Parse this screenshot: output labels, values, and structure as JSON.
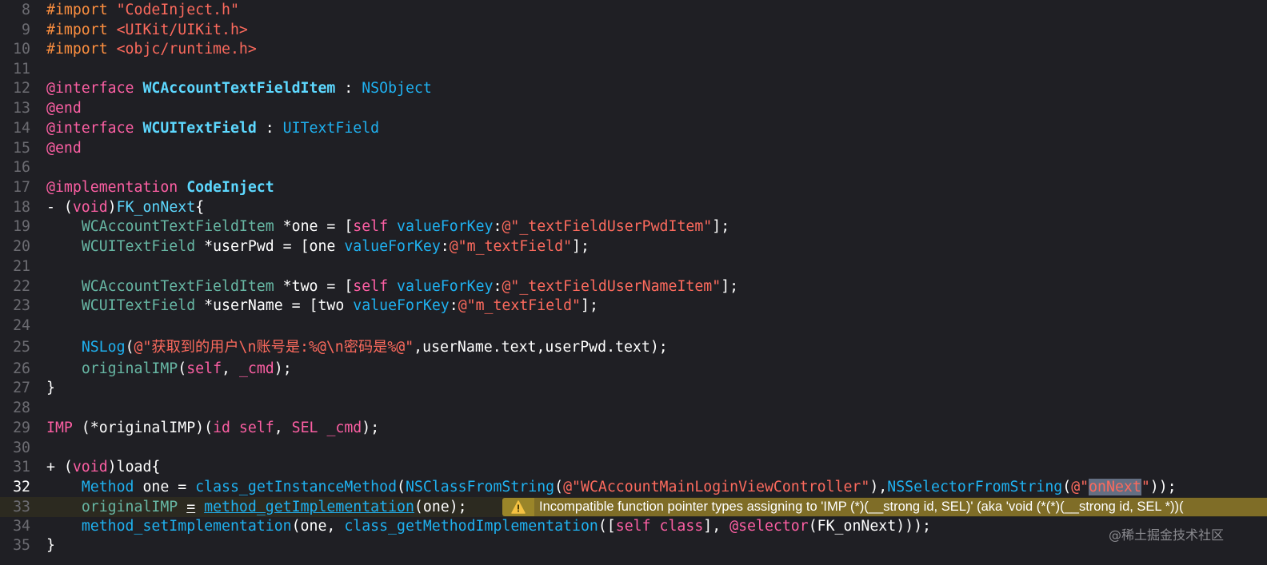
{
  "lines": [
    {
      "num": "8",
      "parts": [
        {
          "t": "#import ",
          "c": "dir"
        },
        {
          "t": "\"CodeInject.h\"",
          "c": "str"
        }
      ]
    },
    {
      "num": "9",
      "parts": [
        {
          "t": "#import ",
          "c": "dir"
        },
        {
          "t": "<UIKit/UIKit.h>",
          "c": "str"
        }
      ]
    },
    {
      "num": "10",
      "parts": [
        {
          "t": "#import ",
          "c": "dir"
        },
        {
          "t": "<objc/runtime.h>",
          "c": "str"
        }
      ]
    },
    {
      "num": "11",
      "parts": []
    },
    {
      "num": "12",
      "parts": [
        {
          "t": "@interface ",
          "c": "kw"
        },
        {
          "t": "WCAccountTextFieldItem",
          "c": "pc"
        },
        {
          "t": " : "
        },
        {
          "t": "NSObject",
          "c": "sy"
        }
      ]
    },
    {
      "num": "13",
      "parts": [
        {
          "t": "@end",
          "c": "kw"
        }
      ]
    },
    {
      "num": "14",
      "parts": [
        {
          "t": "@interface ",
          "c": "kw"
        },
        {
          "t": "WCUITextField",
          "c": "pc"
        },
        {
          "t": " : "
        },
        {
          "t": "UITextField",
          "c": "sy"
        }
      ]
    },
    {
      "num": "15",
      "parts": [
        {
          "t": "@end",
          "c": "kw"
        }
      ]
    },
    {
      "num": "16",
      "parts": []
    },
    {
      "num": "17",
      "parts": [
        {
          "t": "@implementation ",
          "c": "kw"
        },
        {
          "t": "CodeInject",
          "c": "pc"
        }
      ]
    },
    {
      "num": "18",
      "parts": [
        {
          "t": "- ("
        },
        {
          "t": "void",
          "c": "kw"
        },
        {
          "t": ")"
        },
        {
          "t": "FK_onNext",
          "c": "ty"
        },
        {
          "t": "{"
        }
      ]
    },
    {
      "num": "19",
      "parts": [
        {
          "t": "    "
        },
        {
          "t": "WCAccountTextFieldItem",
          "c": "uf"
        },
        {
          "t": " *one = ["
        },
        {
          "t": "self",
          "c": "kw"
        },
        {
          "t": " "
        },
        {
          "t": "valueForKey",
          "c": "sy"
        },
        {
          "t": ":"
        },
        {
          "t": "@\"_textFieldUserPwdItem\"",
          "c": "str"
        },
        {
          "t": "];"
        }
      ]
    },
    {
      "num": "20",
      "parts": [
        {
          "t": "    "
        },
        {
          "t": "WCUITextField",
          "c": "uf"
        },
        {
          "t": " *userPwd = [one "
        },
        {
          "t": "valueForKey",
          "c": "sy"
        },
        {
          "t": ":"
        },
        {
          "t": "@\"m_textField\"",
          "c": "str"
        },
        {
          "t": "];"
        }
      ]
    },
    {
      "num": "21",
      "parts": []
    },
    {
      "num": "22",
      "parts": [
        {
          "t": "    "
        },
        {
          "t": "WCAccountTextFieldItem",
          "c": "uf"
        },
        {
          "t": " *two = ["
        },
        {
          "t": "self",
          "c": "kw"
        },
        {
          "t": " "
        },
        {
          "t": "valueForKey",
          "c": "sy"
        },
        {
          "t": ":"
        },
        {
          "t": "@\"_textFieldUserNameItem\"",
          "c": "str"
        },
        {
          "t": "];"
        }
      ]
    },
    {
      "num": "23",
      "parts": [
        {
          "t": "    "
        },
        {
          "t": "WCUITextField",
          "c": "uf"
        },
        {
          "t": " *userName = [two "
        },
        {
          "t": "valueForKey",
          "c": "sy"
        },
        {
          "t": ":"
        },
        {
          "t": "@\"m_textField\"",
          "c": "str"
        },
        {
          "t": "];"
        }
      ]
    },
    {
      "num": "24",
      "parts": []
    },
    {
      "num": "25",
      "parts": [
        {
          "t": "    "
        },
        {
          "t": "NSLog",
          "c": "sy"
        },
        {
          "t": "("
        },
        {
          "t": "@\"获取到的用户\\n账号是:%@\\n密码是%@\"",
          "c": "str"
        },
        {
          "t": ",userName.text,userPwd.text);"
        }
      ]
    },
    {
      "num": "26",
      "parts": [
        {
          "t": "    "
        },
        {
          "t": "originalIMP",
          "c": "uf"
        },
        {
          "t": "("
        },
        {
          "t": "self",
          "c": "kw"
        },
        {
          "t": ", "
        },
        {
          "t": "_cmd",
          "c": "kw"
        },
        {
          "t": ");"
        }
      ]
    },
    {
      "num": "27",
      "parts": [
        {
          "t": "}"
        }
      ]
    },
    {
      "num": "28",
      "parts": []
    },
    {
      "num": "29",
      "parts": [
        {
          "t": "IMP",
          "c": "kw"
        },
        {
          "t": " (*originalIMP)("
        },
        {
          "t": "id",
          "c": "kw"
        },
        {
          "t": " "
        },
        {
          "t": "self",
          "c": "kw"
        },
        {
          "t": ", "
        },
        {
          "t": "SEL",
          "c": "kw"
        },
        {
          "t": " "
        },
        {
          "t": "_cmd",
          "c": "kw"
        },
        {
          "t": ");"
        }
      ]
    },
    {
      "num": "30",
      "parts": []
    },
    {
      "num": "31",
      "parts": [
        {
          "t": "+ ("
        },
        {
          "t": "void",
          "c": "kw"
        },
        {
          "t": ")load{"
        }
      ]
    },
    {
      "num": "32",
      "cur": true,
      "parts": [
        {
          "t": "    "
        },
        {
          "t": "Method",
          "c": "sy"
        },
        {
          "t": " one = "
        },
        {
          "t": "class_getInstanceMethod",
          "c": "sy"
        },
        {
          "t": "("
        },
        {
          "t": "NSClassFromString",
          "c": "sy"
        },
        {
          "t": "("
        },
        {
          "t": "@\"WCAccountMainLoginViewController\"",
          "c": "str"
        },
        {
          "t": "),"
        },
        {
          "t": "NSSelectorFromString",
          "c": "sy"
        },
        {
          "t": "("
        },
        {
          "t": "@\"",
          "c": "str"
        },
        {
          "t": "onNext",
          "c": "sel"
        },
        {
          "t": "\"",
          "c": "str"
        },
        {
          "t": "));"
        }
      ]
    },
    {
      "num": "33",
      "hl": true,
      "parts": [
        {
          "t": "    "
        },
        {
          "t": "originalIMP",
          "c": "uf"
        },
        {
          "t": " "
        },
        {
          "t": "=",
          "c": "ul"
        },
        {
          "t": " "
        },
        {
          "t": "method_getImplementation",
          "c": "sy ul"
        },
        {
          "t": "(one);",
          "c": "ul0"
        }
      ]
    },
    {
      "num": "34",
      "parts": [
        {
          "t": "    "
        },
        {
          "t": "method_setImplementation",
          "c": "sy"
        },
        {
          "t": "(one, "
        },
        {
          "t": "class_getMethodImplementation",
          "c": "sy"
        },
        {
          "t": "(["
        },
        {
          "t": "self",
          "c": "kw"
        },
        {
          "t": " "
        },
        {
          "t": "class",
          "c": "kw"
        },
        {
          "t": "], "
        },
        {
          "t": "@selector",
          "c": "kw"
        },
        {
          "t": "(FK_onNext)));"
        }
      ]
    },
    {
      "num": "35",
      "parts": [
        {
          "t": "}"
        }
      ]
    }
  ],
  "warning": {
    "text": "Incompatible function pointer types assigning to 'IMP (*)(__strong id, SEL)' (aka 'void (*(*)(__strong id, SEL *))(",
    "icon": "warning-triangle-icon"
  },
  "watermark": "@稀土掘金技术社区",
  "colors": {
    "background": "#1f1f24",
    "keyword": "#fc5fa3",
    "string": "#fc6a5d",
    "type_declaration": "#5dd8ff",
    "warning_bg": "#7f6d27"
  }
}
